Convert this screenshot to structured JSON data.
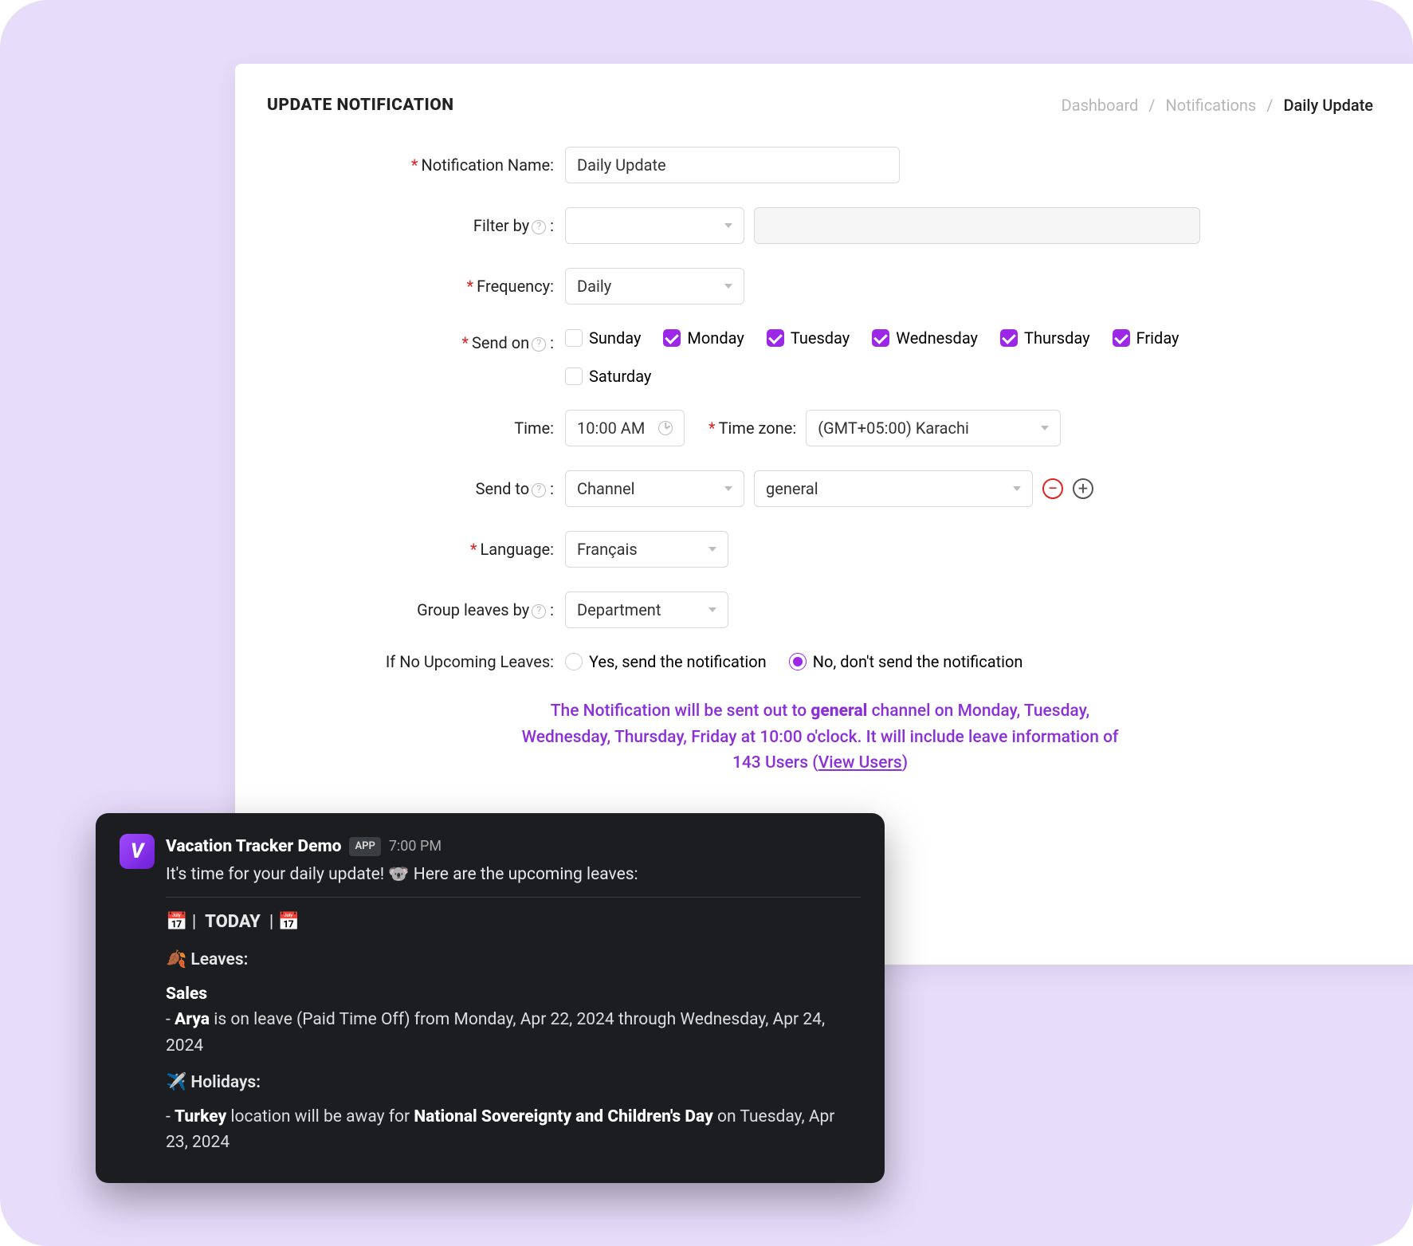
{
  "header": {
    "title": "UPDATE NOTIFICATION",
    "breadcrumb": {
      "b1": "Dashboard",
      "b2": "Notifications",
      "b3": "Daily Update"
    }
  },
  "form": {
    "name_label": "Notification Name:",
    "name_value": "Daily Update",
    "filter_label": "Filter by",
    "freq_label": "Frequency:",
    "freq_value": "Daily",
    "sendon_label": "Send on",
    "days": {
      "sun": {
        "label": "Sunday",
        "checked": false
      },
      "mon": {
        "label": "Monday",
        "checked": true
      },
      "tue": {
        "label": "Tuesday",
        "checked": true
      },
      "wed": {
        "label": "Wednesday",
        "checked": true
      },
      "thu": {
        "label": "Thursday",
        "checked": true
      },
      "fri": {
        "label": "Friday",
        "checked": true
      },
      "sat": {
        "label": "Saturday",
        "checked": false
      }
    },
    "time_label": "Time:",
    "time_value": "10:00 AM",
    "tz_label": "Time zone:",
    "tz_value": "(GMT+05:00) Karachi",
    "sendto_label": "Send to",
    "sendto_type": "Channel",
    "sendto_value": "general",
    "lang_label": "Language:",
    "lang_value": "Français",
    "group_label": "Group leaves by",
    "group_value": "Department",
    "noupcoming_label": "If No Upcoming Leaves:",
    "radio_yes": "Yes, send the notification",
    "radio_no": "No, don't send the notification",
    "radio_selected": "no"
  },
  "summary": {
    "channel": "general",
    "days": "Monday, Tuesday, Wednesday, Thursday, Friday",
    "time": "10:00",
    "user_count": "143",
    "view_link": "View Users"
  },
  "preview": {
    "app_name": "Vacation Tracker Demo",
    "badge": "APP",
    "time": "7:00 PM",
    "intro": "It's time for your daily update! 🐨 Here are the upcoming leaves:",
    "today_label": "TODAY",
    "leaves_title": "🍂 Leaves:",
    "team": "Sales",
    "person": "Arya",
    "leave_text": "is on leave (Paid Time Off) from Monday, Apr 22, 2024 through Wednesday, Apr 24, 2024",
    "holidays_title": "✈️ Holidays:",
    "loc": "Turkey",
    "hol_mid": "location will be away for",
    "hol_name": "National Sovereignty and Children's Day",
    "hol_date": "on Tuesday, Apr 23, 2024"
  }
}
